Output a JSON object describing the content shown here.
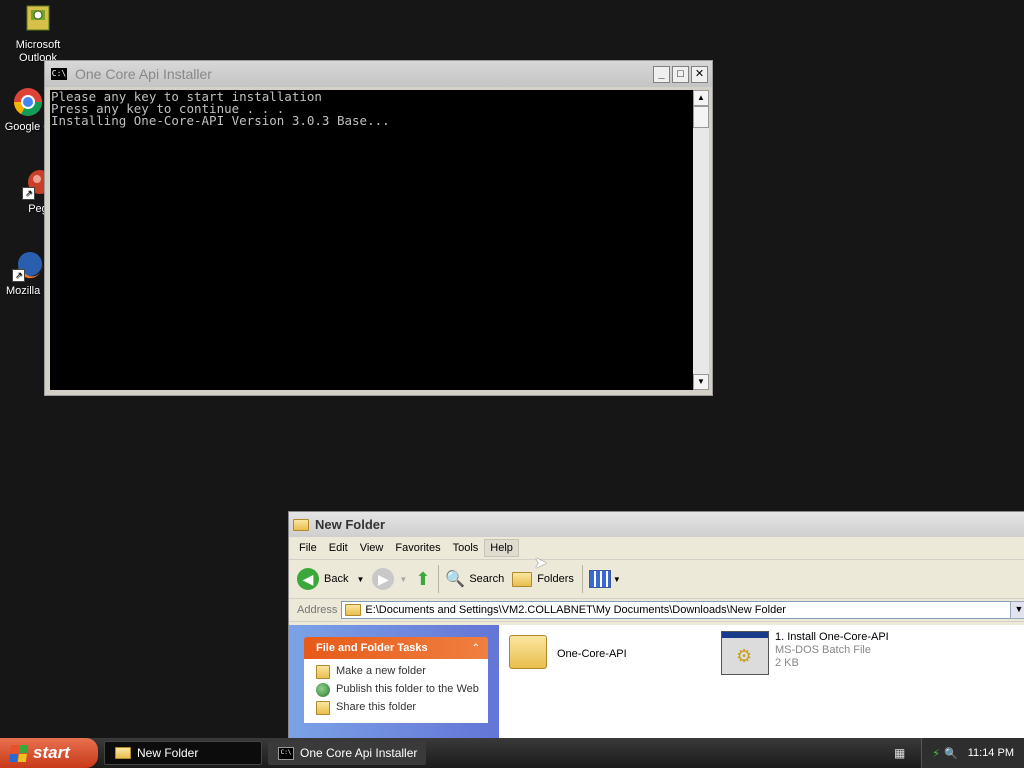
{
  "desktop": {
    "icons": [
      {
        "label": "Microsoft Outlook",
        "icon": "outlook-icon"
      },
      {
        "label": "Google C",
        "icon": "chrome-icon"
      },
      {
        "label": "Peg",
        "icon": "app-icon"
      },
      {
        "label": "Mozilla F",
        "icon": "firefox-icon"
      }
    ]
  },
  "console": {
    "title": "One Core Api Installer",
    "lines": [
      "Please any key to start installation",
      "Press any key to continue . . .",
      "Installing One-Core-API Version 3.0.3 Base..."
    ]
  },
  "explorer": {
    "title": "New Folder",
    "menu": [
      "File",
      "Edit",
      "View",
      "Favorites",
      "Tools",
      "Help"
    ],
    "toolbar": {
      "back": "Back",
      "search": "Search",
      "folders": "Folders"
    },
    "address_label": "Address",
    "address": "E:\\Documents and Settings\\VM2.COLLABNET\\My Documents\\Downloads\\New Folder",
    "tasks": {
      "header": "File and Folder Tasks",
      "items": [
        "Make a new folder",
        "Publish this folder to the Web",
        "Share this folder"
      ]
    },
    "files": [
      {
        "name": "One-Core-API",
        "type": "",
        "size": ""
      },
      {
        "name": "1. Install One-Core-API",
        "type": "MS-DOS Batch File",
        "size": "2 KB"
      }
    ]
  },
  "taskbar": {
    "start": "start",
    "tasks": [
      "New Folder",
      "One Core Api Installer"
    ],
    "clock": "11:14 PM"
  },
  "colors": {
    "desktop": "#161616",
    "console_bg": "#000000",
    "console_text": "#c0c0c0",
    "task_pane": "#6f8ce0",
    "start_button": "#d4502c"
  }
}
